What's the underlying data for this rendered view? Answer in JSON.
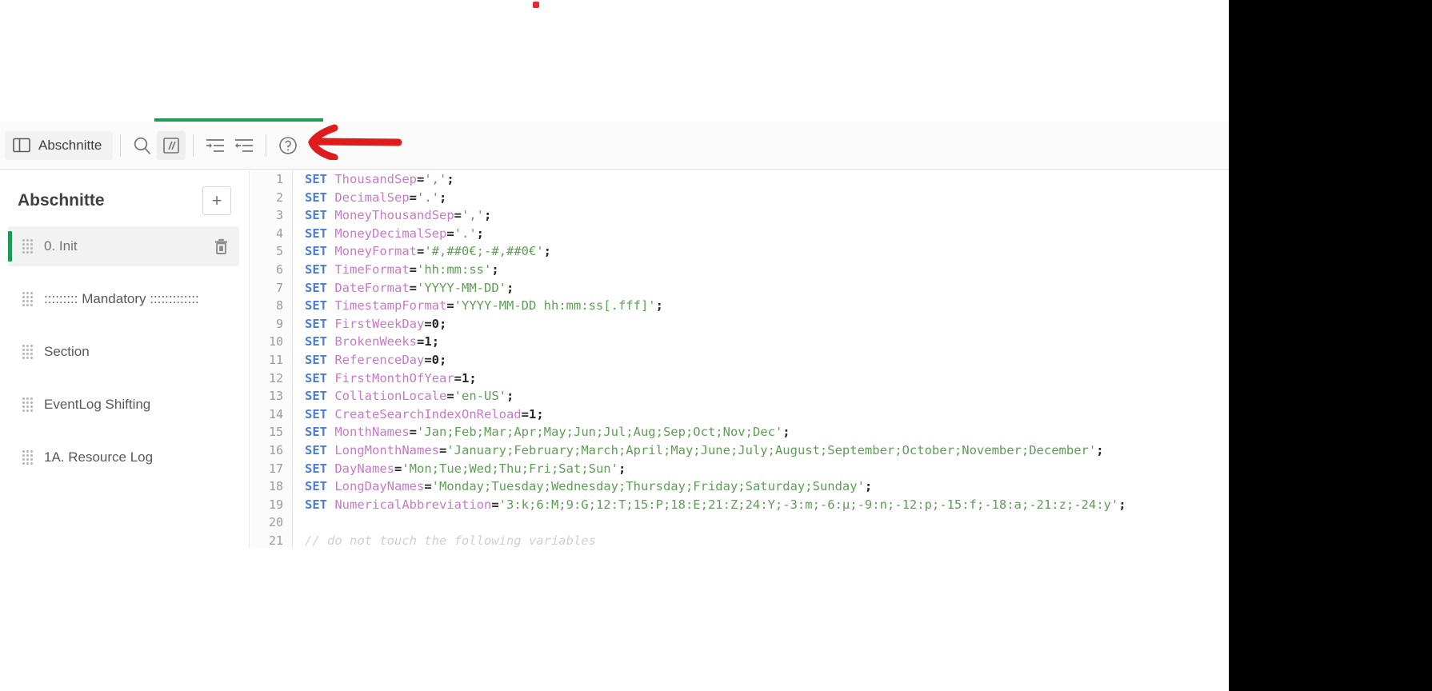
{
  "toolbar": {
    "sections_button_label": "Abschnitte",
    "accent_color": "#1d9a55",
    "buttons": [
      {
        "name": "panel-toggle",
        "icon": "panel-left-icon",
        "label": "Abschnitte"
      },
      {
        "name": "search",
        "icon": "search-icon",
        "label": ""
      },
      {
        "name": "toggle-comment",
        "icon": "comment-slashes-icon",
        "label": "",
        "active": true
      },
      {
        "name": "indent-increase",
        "icon": "indent-increase-icon",
        "label": ""
      },
      {
        "name": "indent-decrease",
        "icon": "indent-decrease-icon",
        "label": ""
      },
      {
        "name": "help",
        "icon": "help-circle-icon",
        "label": ""
      }
    ]
  },
  "sidebar": {
    "title": "Abschnitte",
    "add_label": "+",
    "items": [
      {
        "label": "0. Init",
        "selected": true,
        "has_delete": true
      },
      {
        "label": "::::::::: Mandatory :::::::::::::",
        "selected": false,
        "has_delete": false
      },
      {
        "label": "Section",
        "selected": false,
        "has_delete": false
      },
      {
        "label": "EventLog Shifting",
        "selected": false,
        "has_delete": false
      },
      {
        "label": "1A. Resource Log",
        "selected": false,
        "has_delete": false
      }
    ]
  },
  "editor": {
    "line_numbers": [
      "1",
      "2",
      "3",
      "4",
      "5",
      "6",
      "7",
      "8",
      "9",
      "10",
      "11",
      "12",
      "13",
      "14",
      "15",
      "16",
      "17",
      "18",
      "19",
      "20",
      "21"
    ],
    "lines": [
      {
        "n": 1,
        "kw": "SET",
        "var": "ThousandSep",
        "value": "','",
        "type": "string"
      },
      {
        "n": 2,
        "kw": "SET",
        "var": "DecimalSep",
        "value": "'.'",
        "type": "string"
      },
      {
        "n": 3,
        "kw": "SET",
        "var": "MoneyThousandSep",
        "value": "','",
        "type": "string"
      },
      {
        "n": 4,
        "kw": "SET",
        "var": "MoneyDecimalSep",
        "value": "'.'",
        "type": "string"
      },
      {
        "n": 5,
        "kw": "SET",
        "var": "MoneyFormat",
        "value": "'#,##0€;-#,##0€'",
        "type": "string"
      },
      {
        "n": 6,
        "kw": "SET",
        "var": "TimeFormat",
        "value": "'hh:mm:ss'",
        "type": "string"
      },
      {
        "n": 7,
        "kw": "SET",
        "var": "DateFormat",
        "value": "'YYYY-MM-DD'",
        "type": "string"
      },
      {
        "n": 8,
        "kw": "SET",
        "var": "TimestampFormat",
        "value": "'YYYY-MM-DD hh:mm:ss[.fff]'",
        "type": "string"
      },
      {
        "n": 9,
        "kw": "SET",
        "var": "FirstWeekDay",
        "value": "0",
        "type": "number"
      },
      {
        "n": 10,
        "kw": "SET",
        "var": "BrokenWeeks",
        "value": "1",
        "type": "number"
      },
      {
        "n": 11,
        "kw": "SET",
        "var": "ReferenceDay",
        "value": "0",
        "type": "number"
      },
      {
        "n": 12,
        "kw": "SET",
        "var": "FirstMonthOfYear",
        "value": "1",
        "type": "number"
      },
      {
        "n": 13,
        "kw": "SET",
        "var": "CollationLocale",
        "value": "'en-US'",
        "type": "string"
      },
      {
        "n": 14,
        "kw": "SET",
        "var": "CreateSearchIndexOnReload",
        "value": "1",
        "type": "number"
      },
      {
        "n": 15,
        "kw": "SET",
        "var": "MonthNames",
        "value": "'Jan;Feb;Mar;Apr;May;Jun;Jul;Aug;Sep;Oct;Nov;Dec'",
        "type": "string"
      },
      {
        "n": 16,
        "kw": "SET",
        "var": "LongMonthNames",
        "value": "'January;February;March;April;May;June;July;August;September;October;November;December'",
        "type": "string"
      },
      {
        "n": 17,
        "kw": "SET",
        "var": "DayNames",
        "value": "'Mon;Tue;Wed;Thu;Fri;Sat;Sun'",
        "type": "string"
      },
      {
        "n": 18,
        "kw": "SET",
        "var": "LongDayNames",
        "value": "'Monday;Tuesday;Wednesday;Thursday;Friday;Saturday;Sunday'",
        "type": "string"
      },
      {
        "n": 19,
        "kw": "SET",
        "var": "NumericalAbbreviation",
        "value": "'3:k;6:M;9:G;12:T;15:P;18:E;21:Z;24:Y;-3:m;-6:µ;-9:n;-12:p;-15:f;-18:a;-21:z;-24:y'",
        "type": "string"
      },
      {
        "n": 20,
        "kw": "",
        "var": "",
        "value": "",
        "type": "blank"
      },
      {
        "n": 21,
        "kw": "",
        "var": "",
        "value": "// do not touch the following variables",
        "type": "comment"
      }
    ],
    "colors": {
      "keyword": "#4a7ed6",
      "variable": "#c77ac7",
      "string": "#5f9e56",
      "operator": "#262626",
      "comment": "#cfcfcf",
      "gutter_text": "#9b9b9b"
    }
  },
  "annotations": {
    "arrow_color": "#e01b1b",
    "arrow_direction": "left",
    "dot_color": "#e8262b"
  }
}
